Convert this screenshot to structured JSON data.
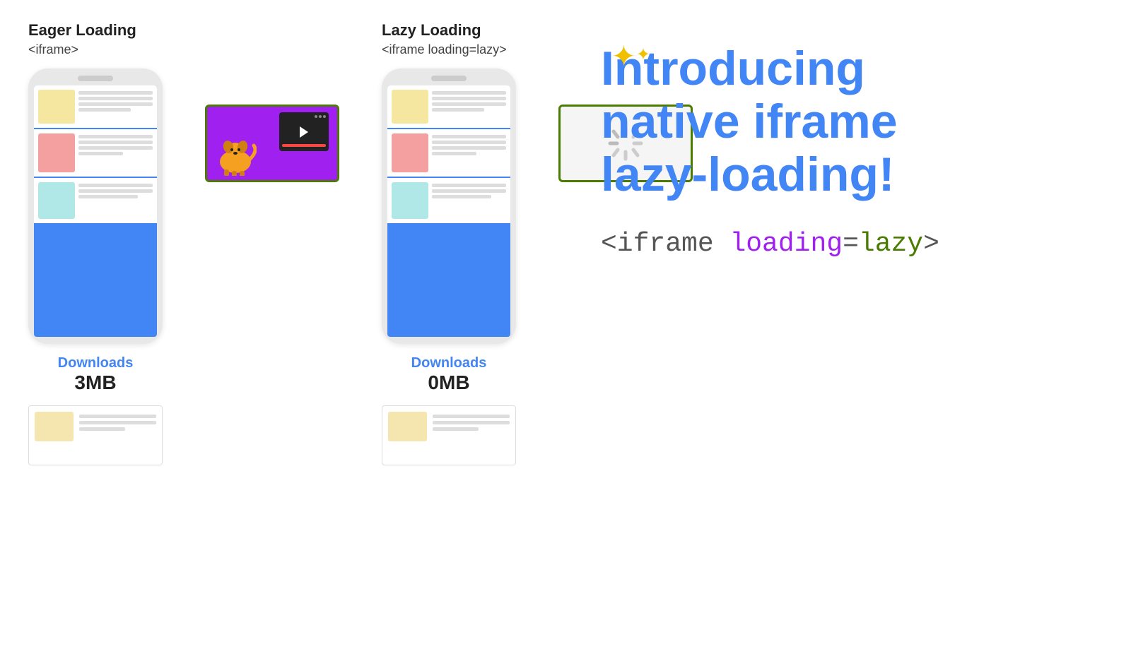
{
  "eager": {
    "title": "Eager Loading",
    "code": "<iframe>",
    "download_label": "Downloads",
    "download_size": "3MB"
  },
  "lazy": {
    "title": "Lazy Loading",
    "code": "<iframe loading=lazy>",
    "download_label": "Downloads",
    "download_size": "0MB"
  },
  "headline": {
    "line1": "Introducing",
    "line2": "native iframe",
    "line3": "lazy-loading!"
  },
  "code_snippet": {
    "prefix": "<iframe ",
    "loading_attr": "loading",
    "equals": "=",
    "lazy_val": "lazy",
    "suffix": ">"
  },
  "sparkle": "✦",
  "sparkle_small": "✦"
}
